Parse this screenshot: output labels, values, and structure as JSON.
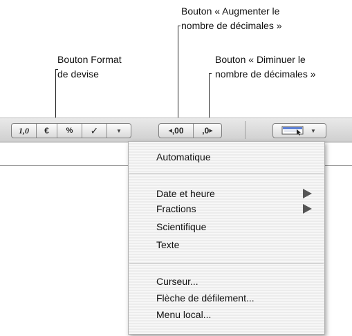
{
  "callouts": {
    "currency": {
      "line1": "Bouton Format",
      "line2": "de devise"
    },
    "increase_decimals": {
      "line1": "Bouton « Augmenter le",
      "line2": "nombre de décimales »"
    },
    "decrease_decimals": {
      "line1": "Bouton « Diminuer le",
      "line2": "nombre de décimales »"
    }
  },
  "toolbar": {
    "format_buttons": {
      "number": "1,0",
      "currency": "€",
      "percent": "%",
      "checkbox": "✓",
      "more": "▼"
    },
    "decimal_buttons": {
      "increase": ",00",
      "decrease": ",0",
      "increase_arrow": "◀",
      "decrease_arrow": "▶"
    },
    "cell_format_dropdown_arrow": "▼"
  },
  "menu": {
    "items": [
      {
        "label": "Automatique"
      },
      {
        "label": "Date et heure",
        "submenu": true
      },
      {
        "label": "Fractions",
        "submenu": true
      },
      {
        "label": "Scientifique"
      },
      {
        "label": "Texte"
      },
      {
        "label": "Curseur..."
      },
      {
        "label": "Flèche de défilement..."
      },
      {
        "label": "Menu local..."
      }
    ]
  },
  "icons": [
    "submenu-arrow-icon",
    "cell-format-icon",
    "dropdown-arrow-icon"
  ]
}
